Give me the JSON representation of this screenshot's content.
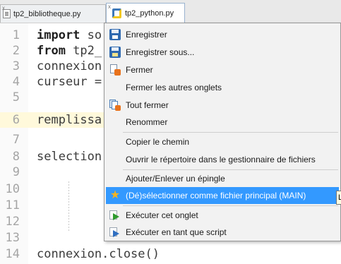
{
  "tabs": [
    {
      "label": "tp2_bibliotheque.py",
      "active": false,
      "close_label": "x"
    },
    {
      "label": "tp2_python.py",
      "active": true,
      "close_label": "x"
    }
  ],
  "editor": {
    "line_numbers": [
      "1",
      "2",
      "3",
      "4",
      "5",
      "6",
      "7",
      "8",
      "9",
      "10",
      "11",
      "12",
      "13",
      "14"
    ],
    "lines": [
      {
        "kw": "import",
        "rest": " so"
      },
      {
        "kw": "from",
        "rest": " tp2_"
      },
      {
        "kw": "",
        "rest": "connexion"
      },
      {
        "kw": "",
        "rest": "curseur ="
      },
      {
        "kw": "",
        "rest": ""
      },
      {
        "kw": "",
        "rest": "remplissa"
      },
      {
        "kw": "",
        "rest": ""
      },
      {
        "kw": "",
        "rest": "selection"
      },
      {
        "kw": "",
        "rest": ""
      },
      {
        "kw": "",
        "rest": ""
      },
      {
        "kw": "",
        "rest": ""
      },
      {
        "kw": "",
        "rest": ""
      },
      {
        "kw": "",
        "rest": ""
      },
      {
        "kw": "",
        "rest": "connexion.close()"
      }
    ],
    "highlighted_line": "6"
  },
  "context_menu": {
    "items": [
      {
        "label": "Enregistrer",
        "icon": "save-icon"
      },
      {
        "label": "Enregistrer sous...",
        "icon": "save-as-icon"
      },
      {
        "label": "Fermer",
        "icon": "close-document-icon"
      },
      {
        "label": "Fermer les autres onglets",
        "icon": ""
      },
      {
        "label": "Tout fermer",
        "icon": "close-all-documents-icon"
      },
      {
        "label": "Renommer",
        "icon": ""
      },
      {
        "label": "Copier le chemin",
        "icon": ""
      },
      {
        "label": "Ouvrir le répertoire dans le gestionnaire de fichiers",
        "icon": ""
      },
      {
        "label": "Ajouter/Enlever un épingle",
        "icon": ""
      },
      {
        "label": "(Dé)sélectionner comme fichier principal (MAIN)",
        "icon": "star-icon",
        "selected": true
      },
      {
        "label": "Exécuter cet onglet",
        "icon": "run-tab-icon"
      },
      {
        "label": "Exécuter en tant que script",
        "icon": "run-script-icon"
      }
    ]
  },
  "tooltip": {
    "text": "Le"
  },
  "colors": {
    "selection": "#3399ff",
    "current_line": "#fff9db",
    "star": "#f5b31e"
  }
}
